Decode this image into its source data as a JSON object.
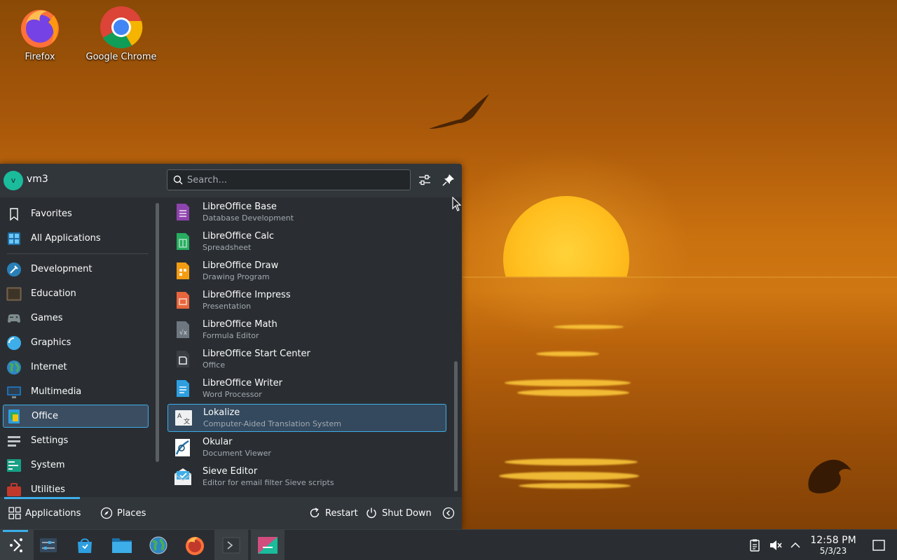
{
  "desktop": {
    "icons": [
      {
        "label": "Firefox",
        "icon": "firefox-icon"
      },
      {
        "label": "Google Chrome",
        "icon": "chrome-icon"
      }
    ]
  },
  "launcher": {
    "user": {
      "initial": "v",
      "name": "vm3"
    },
    "search": {
      "placeholder": "Search..."
    },
    "header_buttons": [
      "configure-icon",
      "pin-icon"
    ],
    "categories": [
      {
        "label": "Favorites",
        "icon": "bookmark-icon"
      },
      {
        "label": "All Applications",
        "icon": "grid-icon"
      },
      {
        "label": "Development",
        "icon": "development-icon"
      },
      {
        "label": "Education",
        "icon": "education-icon"
      },
      {
        "label": "Games",
        "icon": "gamepad-icon"
      },
      {
        "label": "Graphics",
        "icon": "graphics-icon"
      },
      {
        "label": "Internet",
        "icon": "globe-icon"
      },
      {
        "label": "Multimedia",
        "icon": "multimedia-icon"
      },
      {
        "label": "Office",
        "icon": "office-icon",
        "selected": true
      },
      {
        "label": "Settings",
        "icon": "settings-icon"
      },
      {
        "label": "System",
        "icon": "system-icon"
      },
      {
        "label": "Utilities",
        "icon": "utilities-icon"
      }
    ],
    "apps": [
      {
        "name": "LibreOffice Base",
        "desc": "Database Development",
        "icon": "libreoffice-base-icon",
        "color": "#8e44ad"
      },
      {
        "name": "LibreOffice Calc",
        "desc": "Spreadsheet",
        "icon": "libreoffice-calc-icon",
        "color": "#27ae60"
      },
      {
        "name": "LibreOffice Draw",
        "desc": "Drawing Program",
        "icon": "libreoffice-draw-icon",
        "color": "#f39c12"
      },
      {
        "name": "LibreOffice Impress",
        "desc": "Presentation",
        "icon": "libreoffice-impress-icon",
        "color": "#e8663d"
      },
      {
        "name": "LibreOffice Math",
        "desc": "Formula Editor",
        "icon": "libreoffice-math-icon",
        "color": "#6e7780"
      },
      {
        "name": "LibreOffice Start Center",
        "desc": "Office",
        "icon": "libreoffice-start-icon",
        "color": "#3a3f44"
      },
      {
        "name": "LibreOffice Writer",
        "desc": "Word Processor",
        "icon": "libreoffice-writer-icon",
        "color": "#2d9fe0"
      },
      {
        "name": "Lokalize",
        "desc": "Computer-Aided Translation System",
        "icon": "lokalize-icon",
        "color": "#eff0f1",
        "selected": true
      },
      {
        "name": "Okular",
        "desc": "Document Viewer",
        "icon": "okular-icon",
        "color": "#ffffff"
      },
      {
        "name": "Sieve Editor",
        "desc": "Editor for email filter Sieve scripts",
        "icon": "sieve-editor-icon",
        "color": "#3daee9"
      }
    ],
    "footer": {
      "applications_label": "Applications",
      "places_label": "Places",
      "restart_label": "Restart",
      "shutdown_label": "Shut Down"
    }
  },
  "taskbar": {
    "items": [
      "launcher-icon",
      "system-settings-icon",
      "discover-icon",
      "file-manager-icon",
      "globe-icon",
      "firefox-icon",
      "terminal-icon",
      "kate-icon"
    ],
    "clock": {
      "time": "12:58 PM",
      "date": "5/3/23"
    }
  },
  "colors": {
    "accent": "#3daee9",
    "panel": "#2a2e32",
    "header": "#31363b"
  }
}
